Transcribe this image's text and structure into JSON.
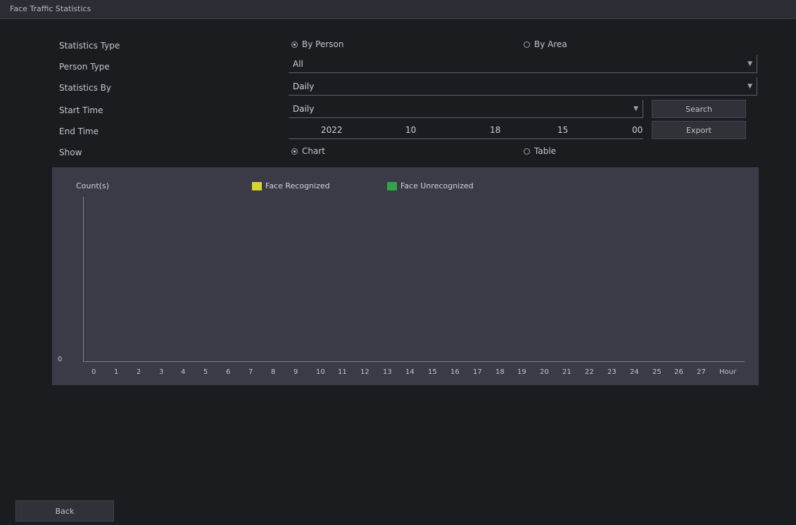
{
  "window": {
    "title": "Face Traffic Statistics"
  },
  "form": {
    "labels": [
      "Statistics Type",
      "Person Type",
      "Statistics By",
      "Start Time",
      "End Time",
      "Show"
    ],
    "stat_type": {
      "option1": "By Person",
      "option2": "By Area"
    },
    "person_type": {
      "value": "All"
    },
    "stat_by": {
      "value": "Daily"
    },
    "start_time": {
      "value": "Daily"
    },
    "end_time": {
      "year": "2022",
      "month": "10",
      "day": "18",
      "hour": "15",
      "minute": "00"
    },
    "buttons": {
      "search": "Search",
      "export": "Export"
    },
    "show": {
      "option1": "Chart",
      "option2": "Table"
    }
  },
  "chart": {
    "ylabel": "Count(s)",
    "legend": [
      {
        "label": "Face Recognized",
        "color": "#d8d430"
      },
      {
        "label": "Face Unrecognized",
        "color": "#33a24a"
      }
    ],
    "y_zero": "0",
    "x_ticks": [
      "0",
      "1",
      "2",
      "3",
      "4",
      "5",
      "6",
      "7",
      "8",
      "9",
      "10",
      "11",
      "12",
      "13",
      "14",
      "15",
      "16",
      "17",
      "18",
      "19",
      "20",
      "21",
      "22",
      "23",
      "24",
      "25",
      "26",
      "27",
      "Hour"
    ]
  },
  "footer": {
    "back_label": "Back"
  },
  "chart_data": {
    "type": "bar",
    "categories": [
      "0",
      "1",
      "2",
      "3",
      "4",
      "5",
      "6",
      "7",
      "8",
      "9",
      "10",
      "11",
      "12",
      "13",
      "14",
      "15",
      "16",
      "17",
      "18",
      "19",
      "20",
      "21",
      "22",
      "23",
      "24",
      "25",
      "26",
      "27"
    ],
    "series": [
      {
        "name": "Face Recognized",
        "values": [
          0,
          0,
          0,
          0,
          0,
          0,
          0,
          0,
          0,
          0,
          0,
          0,
          0,
          0,
          0,
          0,
          0,
          0,
          0,
          0,
          0,
          0,
          0,
          0,
          0,
          0,
          0,
          0
        ]
      },
      {
        "name": "Face Unrecognized",
        "values": [
          0,
          0,
          0,
          0,
          0,
          0,
          0,
          0,
          0,
          0,
          0,
          0,
          0,
          0,
          0,
          0,
          0,
          0,
          0,
          0,
          0,
          0,
          0,
          0,
          0,
          0,
          0,
          0
        ]
      }
    ],
    "ylabel": "Count(s)",
    "xlabel": "Hour"
  }
}
